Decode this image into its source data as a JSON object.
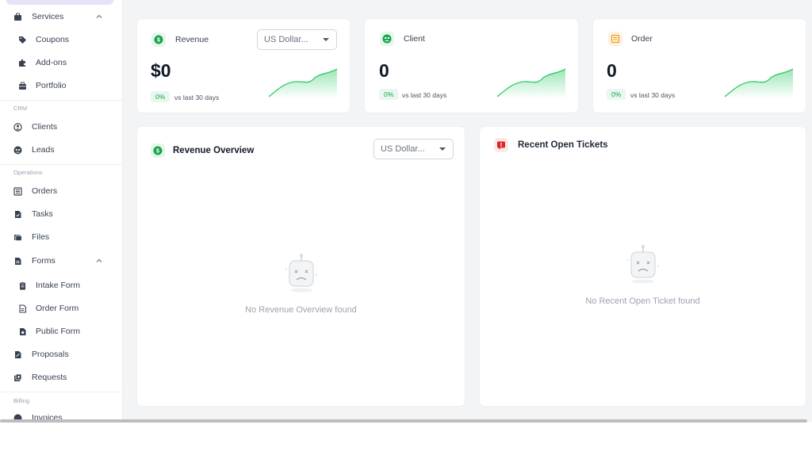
{
  "sidebar": {
    "items": [
      {
        "id": "services",
        "label": "Services",
        "icon": "briefcase-icon",
        "expanded": true
      },
      {
        "id": "coupons",
        "label": "Coupons",
        "icon": "tag-icon"
      },
      {
        "id": "addons",
        "label": "Add-ons",
        "icon": "puzzle-icon"
      },
      {
        "id": "portfolio",
        "label": "Portfolio",
        "icon": "portfolio-icon"
      },
      {
        "id": "clients",
        "label": "Clients",
        "icon": "user-icon"
      },
      {
        "id": "leads",
        "label": "Leads",
        "icon": "leads-icon"
      },
      {
        "id": "orders",
        "label": "Orders",
        "icon": "orders-icon"
      },
      {
        "id": "tasks",
        "label": "Tasks",
        "icon": "task-icon"
      },
      {
        "id": "files",
        "label": "Files",
        "icon": "folder-icon"
      },
      {
        "id": "forms",
        "label": "Forms",
        "icon": "form-icon",
        "expanded": true
      },
      {
        "id": "intake",
        "label": "Intake Form",
        "icon": "clipboard-icon"
      },
      {
        "id": "orderform",
        "label": "Order Form",
        "icon": "document-icon"
      },
      {
        "id": "publicform",
        "label": "Public Form",
        "icon": "document-icon"
      },
      {
        "id": "proposals",
        "label": "Proposals",
        "icon": "proposal-icon"
      },
      {
        "id": "requests",
        "label": "Requests",
        "icon": "request-icon"
      },
      {
        "id": "invoices",
        "label": "Invoices",
        "icon": "invoice-icon"
      }
    ],
    "sections": {
      "crm": "CRM",
      "operations": "Operations",
      "billing": "Billing"
    }
  },
  "stats": [
    {
      "id": "revenue",
      "title": "Revenue",
      "value": "$0",
      "change": "0%",
      "compare": "vs last 30 days",
      "currency": "US Dollar...",
      "icon": "dollar-icon",
      "icon_color": "#16a34a"
    },
    {
      "id": "client",
      "title": "Client",
      "value": "0",
      "change": "0%",
      "compare": "vs last 30 days",
      "icon": "client-group-icon",
      "icon_color": "#16a34a"
    },
    {
      "id": "order",
      "title": "Order",
      "value": "0",
      "change": "0%",
      "compare": "vs last 30 days",
      "icon": "order-box-icon",
      "icon_color": "#f59e0b"
    }
  ],
  "revenue_overview": {
    "title": "Revenue Overview",
    "currency": "US Dollar...",
    "empty": "No Revenue Overview found",
    "icon": "dollar-icon"
  },
  "tickets": {
    "title": "Recent Open Tickets",
    "empty": "No Recent Open Ticket found",
    "icon": "alert-icon"
  },
  "colors": {
    "accent_green": "#22c55e",
    "badge_green": "#16a34a",
    "ticket_red": "#dc2626"
  }
}
